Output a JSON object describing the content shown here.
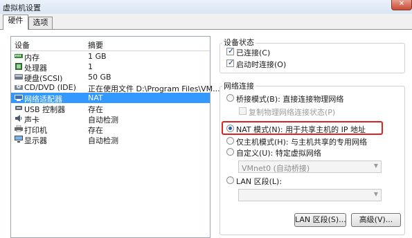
{
  "window": {
    "title": "虚拟机设置"
  },
  "tabs": [
    {
      "label": "硬件"
    },
    {
      "label": "选项"
    }
  ],
  "device_list": {
    "headers": {
      "device": "设备",
      "summary": "摘要"
    },
    "rows": [
      {
        "name": "内存",
        "summary": "1 GB",
        "icon": "memory-icon"
      },
      {
        "name": "处理器",
        "summary": "1",
        "icon": "processor-icon"
      },
      {
        "name": "硬盘(SCSI)",
        "summary": "50 GB",
        "icon": "hard-disk-icon"
      },
      {
        "name": "CD/DVD (IDE)",
        "summary": "正在使用文件 D:\\Program Files\\VM...",
        "icon": "cd-dvd-icon"
      },
      {
        "name": "网络适配器",
        "summary": "NAT",
        "icon": "network-adapter-icon",
        "selected": true
      },
      {
        "name": "USB 控制器",
        "summary": "存在",
        "icon": "usb-icon"
      },
      {
        "name": "声卡",
        "summary": "自动检测",
        "icon": "sound-card-icon"
      },
      {
        "name": "打印机",
        "summary": "存在",
        "icon": "printer-icon"
      },
      {
        "name": "显示器",
        "summary": "自动检测",
        "icon": "display-icon"
      }
    ]
  },
  "device_status": {
    "title": "设备状态",
    "connected": {
      "label": "已连接(C)",
      "checked": true
    },
    "connect_at_power_on": {
      "label": "启动时连接(O)",
      "checked": true
    }
  },
  "network_connection": {
    "title": "网络连接",
    "bridged": {
      "label": "桥接模式(B): 直接连接物理网络",
      "selected": false
    },
    "replicate_state": {
      "label": "复制物理网络连接状态(P)",
      "checked": false,
      "disabled": true
    },
    "nat": {
      "label": "NAT 模式(N): 用于共享主机的 IP 地址",
      "selected": true
    },
    "host_only": {
      "label": "仅主机模式(H): 与主机共享的专用网络",
      "selected": false
    },
    "custom": {
      "label": "自定义(U): 特定虚拟网络",
      "selected": false
    },
    "custom_select": {
      "value": "VMnet0 (自动桥接)"
    },
    "lan_segment": {
      "label": "LAN 区段(L):",
      "selected": false
    },
    "lan_select": {
      "value": ""
    },
    "lan_segments_button": {
      "label": "LAN 区段(S)..."
    },
    "advanced_button": {
      "label": "高级(V)..."
    }
  },
  "colors": {
    "selection": "#3399ff",
    "highlight": "#e02020"
  }
}
